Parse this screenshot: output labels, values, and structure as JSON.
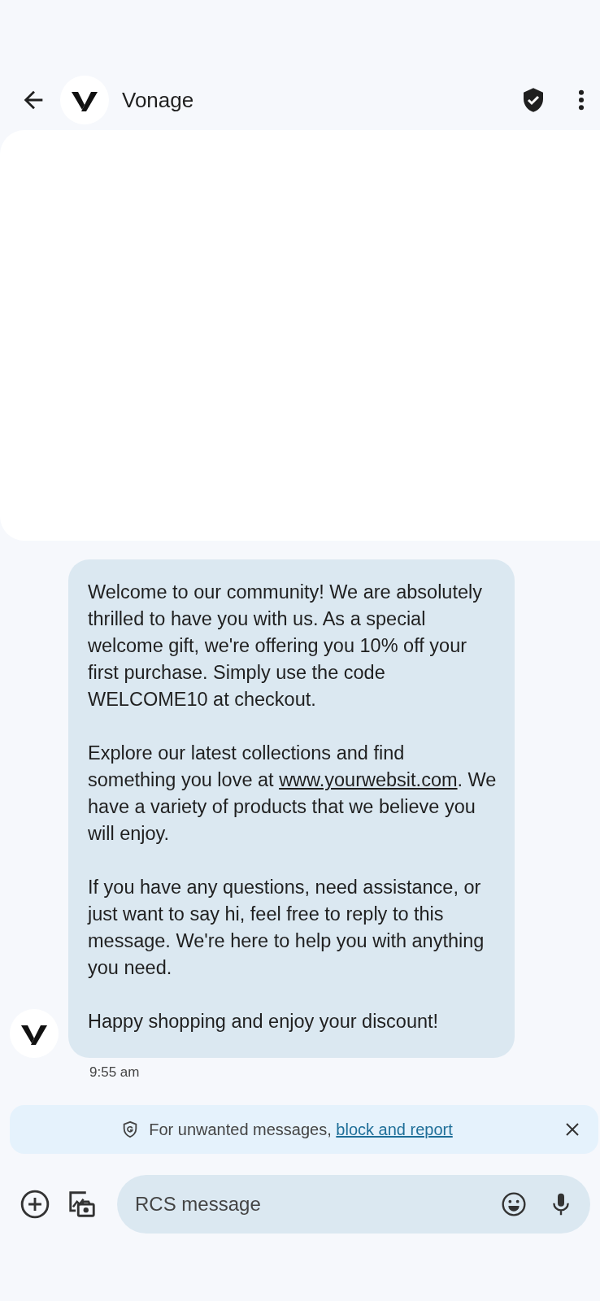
{
  "header": {
    "title": "Vonage"
  },
  "message": {
    "paragraphs": [
      {
        "text": "Welcome to our community! We are absolutely thrilled to have you with us. As a special welcome gift, we're offering you 10% off your first purchase. Simply use the code WELCOME10 at checkout."
      },
      {
        "text": "Explore our latest collections and find something you love at ",
        "link": "www.yourwebsit.com",
        "after": ". We have a variety of products that we believe you will enjoy."
      },
      {
        "text": "If you have any questions, need assistance, or just want to say hi, feel free to reply to this message. We're here to help you with anything you need."
      },
      {
        "text": "Happy shopping and enjoy your discount!"
      }
    ],
    "time": "9:55 am"
  },
  "banner": {
    "text": "For unwanted messages, ",
    "link": "block and report"
  },
  "compose": {
    "placeholder": "RCS message"
  }
}
